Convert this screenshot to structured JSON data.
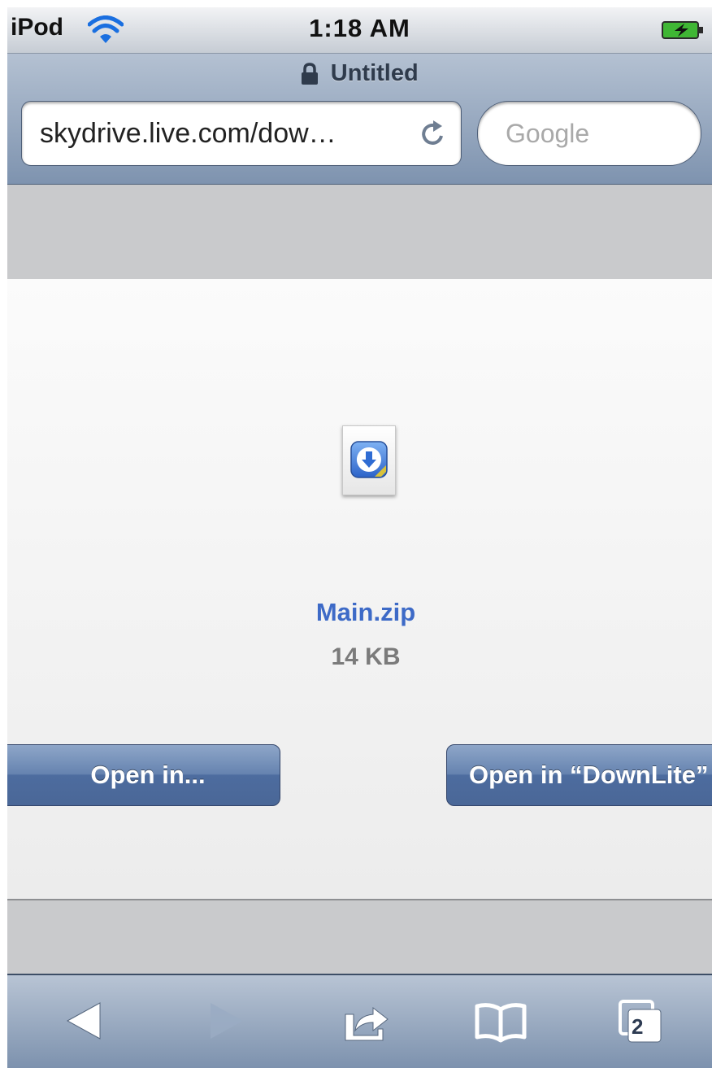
{
  "status_bar": {
    "carrier": "iPod",
    "time": "1:18 AM",
    "wifi_icon": "wifi-icon",
    "battery_icon": "battery-charging-icon"
  },
  "header": {
    "page_title": "Untitled",
    "lock_icon": "lock-icon",
    "url": "skydrive.live.com/dow…",
    "reload_icon": "reload-icon",
    "search_placeholder": "Google"
  },
  "download": {
    "file_icon": "zip-file-icon",
    "file_name": "Main.zip",
    "file_size": "14 KB",
    "open_in_label": "Open in...",
    "open_in_app_label": "Open in “DownLite”"
  },
  "toolbar": {
    "back_icon": "back-arrow-icon",
    "forward_icon": "forward-arrow-icon",
    "share_icon": "share-icon",
    "bookmarks_icon": "bookmarks-book-icon",
    "tabs_icon": "pages-icon",
    "tab_count": "2"
  },
  "colors": {
    "link_blue": "#3d6ac7",
    "button_blue": "#4d6c9f",
    "chrome_blue": "#7e93af",
    "gray_band": "#c9cacc"
  }
}
